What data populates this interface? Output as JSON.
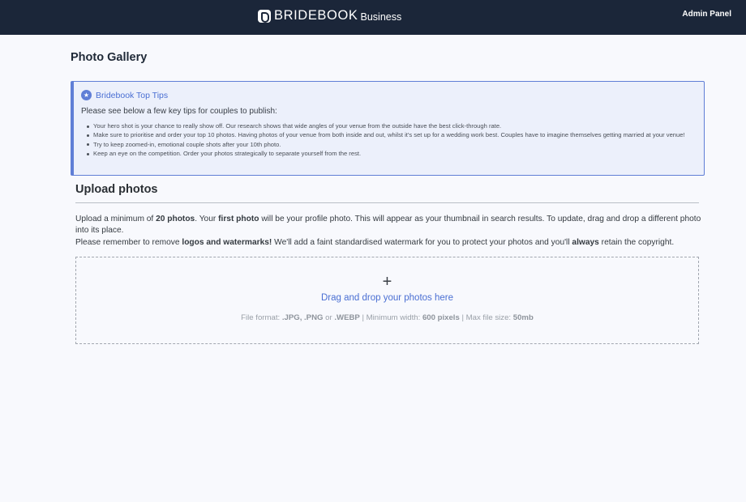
{
  "header": {
    "brand": "BRIDEBOOK",
    "brand_suffix": "Business",
    "admin_link": "Admin Panel"
  },
  "page": {
    "title": "Photo Gallery"
  },
  "tips": {
    "icon": "star-icon",
    "title": "Bridebook Top Tips",
    "intro": "Please see below a few key tips for couples to publish:",
    "items": [
      "Your hero shot is your chance to really show off. Our research shows that wide angles of your venue from the outside have the best click-through rate.",
      "Make sure to prioritise and order your top 10 photos. Having photos of your venue from both inside and out, whilst it's set up for a wedding work best. Couples have to imagine themselves getting married at your venue!",
      "Try to keep zoomed-in, emotional couple shots after your 10th photo.",
      "Keep an eye on the competition. Order your photos strategically to separate yourself from the rest."
    ]
  },
  "upload": {
    "title": "Upload photos",
    "p1_a": "Upload a minimum of ",
    "p1_b": "20 photos",
    "p1_c": ". Your ",
    "p1_d": "first photo",
    "p1_e": " will be your profile photo. This will appear as your thumbnail in search results. To update, drag and drop a different photo into its place.",
    "p2_a": "Please remember to remove ",
    "p2_b": "logos and watermarks!",
    "p2_c": " We'll add a faint standardised watermark for you to protect your photos and you'll ",
    "p2_d": "always",
    "p2_e": " retain the copyright."
  },
  "dropzone": {
    "icon": "plus-icon",
    "plus": "+",
    "label": "Drag and drop your photos here",
    "hint_a": "File format: ",
    "hint_b": ".JPG, .PNG",
    "hint_c": " or ",
    "hint_d": ".WEBP",
    "hint_e": " | Minimum width: ",
    "hint_f": "600 pixels",
    "hint_g": " | Max file size: ",
    "hint_h": "50mb"
  },
  "colors": {
    "header_bg": "#1b2639",
    "accent": "#4a6fd3",
    "tips_bg": "#ecf0fb",
    "page_bg": "#f8f9fd"
  }
}
